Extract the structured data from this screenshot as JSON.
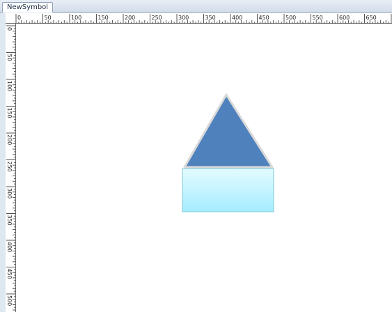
{
  "document_tab": {
    "label": "NewSymbol"
  },
  "rulers": {
    "horizontal_labels": [
      "0",
      "50",
      "100",
      "150",
      "200",
      "250",
      "300",
      "350",
      "400",
      "450",
      "500",
      "550",
      "600",
      "650"
    ],
    "vertical_labels": [
      "0",
      "50",
      "100",
      "150",
      "200",
      "250",
      "300",
      "350",
      "400",
      "450",
      "500"
    ]
  },
  "shapes": {
    "triangle": {
      "fill": "#4f81bd",
      "outline": "#d9d9d9"
    },
    "rectangle": {
      "fill_top": "#e3fbff",
      "fill_bottom": "#a6edff",
      "outline": "#7fc8d8"
    }
  }
}
